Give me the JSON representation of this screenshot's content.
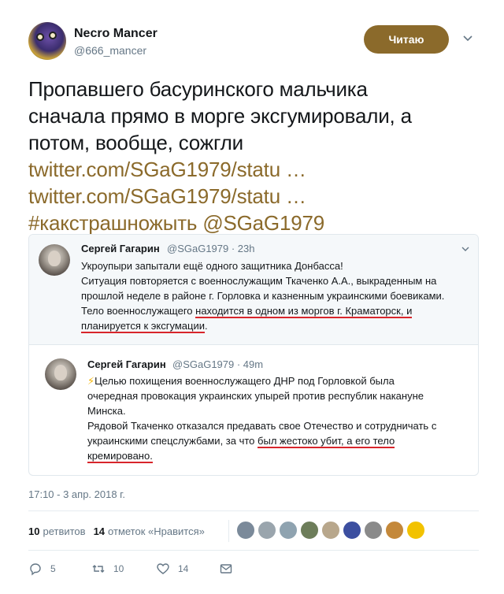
{
  "author": {
    "name": "Necro Mancer",
    "handle": "@666_mancer",
    "follow_label": "Читаю"
  },
  "tweet": {
    "lines": [
      "Пропавшего басуринского мальчика",
      "сначала прямо в морге эксгумировали, а",
      "потом, вообще, сожгли"
    ],
    "link1": "twitter.com/SGaG1979/statu …",
    "link2": "twitter.com/SGaG1979/statu …",
    "hashtag": "#какстрашножыть",
    "mention": "@SGaG1979"
  },
  "quote1": {
    "name": "Сергей Гагарин",
    "meta": "@SGaG1979 · 23h",
    "line1": "Укроупыри запытали ещё одного защитника Донбасса!",
    "line2": "Ситуация повторяется с военнослужащим Ткаченко А.А., выкраденным на",
    "line3": "прошлой неделе в районе г. Горловка и казненным украинскими боевиками.",
    "line4_a": "Тело военнослужащего ",
    "line4_b": "находится в одном из моргов г. Краматорск, и",
    "line5": "планируется к эксгумации",
    "line5_end": "."
  },
  "quote2": {
    "name": "Сергей Гагарин",
    "meta": "@SGaG1979 · 49m",
    "bolt": "⚡",
    "line1": "Целью похищения военнослужащего ДНР под Горловкой была",
    "line2": "очередная провокация украинских упырей против республик накануне",
    "line3": "Минска.",
    "line4": "Рядовой Ткаченко отказался предавать свое Отечество и сотрудничать с",
    "line5_a": "украинскими спецслужбами, за что ",
    "line5_b": "был жестоко убит, а его тело",
    "line6": "кремировано."
  },
  "timestamp": "17:10 - 3 апр. 2018 г.",
  "stats": {
    "retweets_count": "10",
    "retweets_label": "ретвитов",
    "likes_count": "14",
    "likes_label": "отметок «Нравится»"
  },
  "likers_colors": [
    "#7b8a9a",
    "#9aa5ad",
    "#8fa3b0",
    "#6d7d5a",
    "#b8a78c",
    "#3c4fa0",
    "#8a8a8a",
    "#c4883a",
    "#f2c200"
  ],
  "actions": {
    "reply_count": "5",
    "retweet_count": "10",
    "like_count": "14"
  },
  "colors": {
    "accent": "#8b6a2b",
    "underline": "#d8252b"
  }
}
